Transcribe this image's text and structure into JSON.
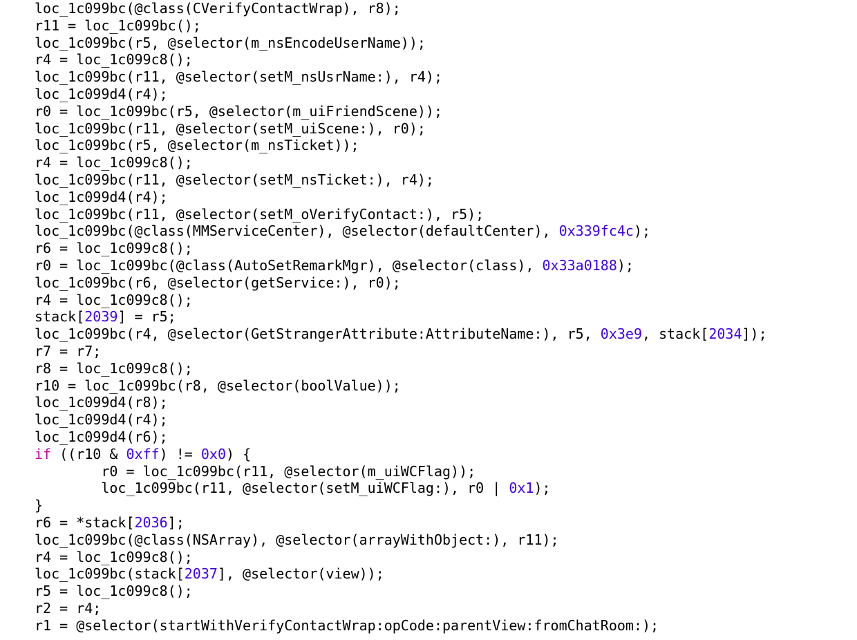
{
  "colors": {
    "keyword": "#c902a5",
    "number": "#3f00e2",
    "text": "#000000",
    "background": "#ffffff"
  },
  "code_lines": [
    [
      {
        "t": "loc_1c099bc(@class(CVerifyContactWrap), r8);",
        "c": "t"
      }
    ],
    [
      {
        "t": "r11 = loc_1c099bc();",
        "c": "t"
      }
    ],
    [
      {
        "t": "loc_1c099bc(r5, @selector(m_nsEncodeUserName));",
        "c": "t"
      }
    ],
    [
      {
        "t": "r4 = loc_1c099c8();",
        "c": "t"
      }
    ],
    [
      {
        "t": "loc_1c099bc(r11, @selector(setM_nsUsrName:), r4);",
        "c": "t"
      }
    ],
    [
      {
        "t": "loc_1c099d4(r4);",
        "c": "t"
      }
    ],
    [
      {
        "t": "r0 = loc_1c099bc(r5, @selector(m_uiFriendScene));",
        "c": "t"
      }
    ],
    [
      {
        "t": "loc_1c099bc(r11, @selector(setM_uiScene:), r0);",
        "c": "t"
      }
    ],
    [
      {
        "t": "loc_1c099bc(r5, @selector(m_nsTicket));",
        "c": "t"
      }
    ],
    [
      {
        "t": "r4 = loc_1c099c8();",
        "c": "t"
      }
    ],
    [
      {
        "t": "loc_1c099bc(r11, @selector(setM_nsTicket:), r4);",
        "c": "t"
      }
    ],
    [
      {
        "t": "loc_1c099d4(r4);",
        "c": "t"
      }
    ],
    [
      {
        "t": "loc_1c099bc(r11, @selector(setM_oVerifyContact:), r5);",
        "c": "t"
      }
    ],
    [
      {
        "t": "loc_1c099bc(@class(MMServiceCenter), @selector(defaultCenter), ",
        "c": "t"
      },
      {
        "t": "0x339fc4c",
        "c": "n"
      },
      {
        "t": ");",
        "c": "t"
      }
    ],
    [
      {
        "t": "r6 = loc_1c099c8();",
        "c": "t"
      }
    ],
    [
      {
        "t": "r0 = loc_1c099bc(@class(AutoSetRemarkMgr), @selector(class), ",
        "c": "t"
      },
      {
        "t": "0x33a0188",
        "c": "n"
      },
      {
        "t": ");",
        "c": "t"
      }
    ],
    [
      {
        "t": "loc_1c099bc(r6, @selector(getService:), r0);",
        "c": "t"
      }
    ],
    [
      {
        "t": "r4 = loc_1c099c8();",
        "c": "t"
      }
    ],
    [
      {
        "t": "stack[",
        "c": "t"
      },
      {
        "t": "2039",
        "c": "n"
      },
      {
        "t": "] = r5;",
        "c": "t"
      }
    ],
    [
      {
        "t": "loc_1c099bc(r4, @selector(GetStrangerAttribute:AttributeName:), r5, ",
        "c": "t"
      },
      {
        "t": "0x3e9",
        "c": "n"
      },
      {
        "t": ", stack[",
        "c": "t"
      },
      {
        "t": "2034",
        "c": "n"
      },
      {
        "t": "]);",
        "c": "t"
      }
    ],
    [
      {
        "t": "r7 = r7;",
        "c": "t"
      }
    ],
    [
      {
        "t": "r8 = loc_1c099c8();",
        "c": "t"
      }
    ],
    [
      {
        "t": "r10 = loc_1c099bc(r8, @selector(boolValue));",
        "c": "t"
      }
    ],
    [
      {
        "t": "loc_1c099d4(r8);",
        "c": "t"
      }
    ],
    [
      {
        "t": "loc_1c099d4(r4);",
        "c": "t"
      }
    ],
    [
      {
        "t": "loc_1c099d4(r6);",
        "c": "t"
      }
    ],
    [
      {
        "t": "if",
        "c": "k"
      },
      {
        "t": " ((r10 & ",
        "c": "t"
      },
      {
        "t": "0xff",
        "c": "n"
      },
      {
        "t": ") != ",
        "c": "t"
      },
      {
        "t": "0x0",
        "c": "n"
      },
      {
        "t": ") {",
        "c": "t"
      }
    ],
    [
      {
        "t": "        r0 = loc_1c099bc(r11, @selector(m_uiWCFlag));",
        "c": "t"
      }
    ],
    [
      {
        "t": "        loc_1c099bc(r11, @selector(setM_uiWCFlag:), r0 | ",
        "c": "t"
      },
      {
        "t": "0x1",
        "c": "n"
      },
      {
        "t": ");",
        "c": "t"
      }
    ],
    [
      {
        "t": "}",
        "c": "t"
      }
    ],
    [
      {
        "t": "r6 = *stack[",
        "c": "t"
      },
      {
        "t": "2036",
        "c": "n"
      },
      {
        "t": "];",
        "c": "t"
      }
    ],
    [
      {
        "t": "loc_1c099bc(@class(NSArray), @selector(arrayWithObject:), r11);",
        "c": "t"
      }
    ],
    [
      {
        "t": "r4 = loc_1c099c8();",
        "c": "t"
      }
    ],
    [
      {
        "t": "loc_1c099bc(stack[",
        "c": "t"
      },
      {
        "t": "2037",
        "c": "n"
      },
      {
        "t": "], @selector(view));",
        "c": "t"
      }
    ],
    [
      {
        "t": "r5 = loc_1c099c8();",
        "c": "t"
      }
    ],
    [
      {
        "t": "r2 = r4;",
        "c": "t"
      }
    ],
    [
      {
        "t": "r1 = @selector(startWithVerifyContactWrap:opCode:parentView:fromChatRoom:);",
        "c": "t"
      }
    ]
  ]
}
